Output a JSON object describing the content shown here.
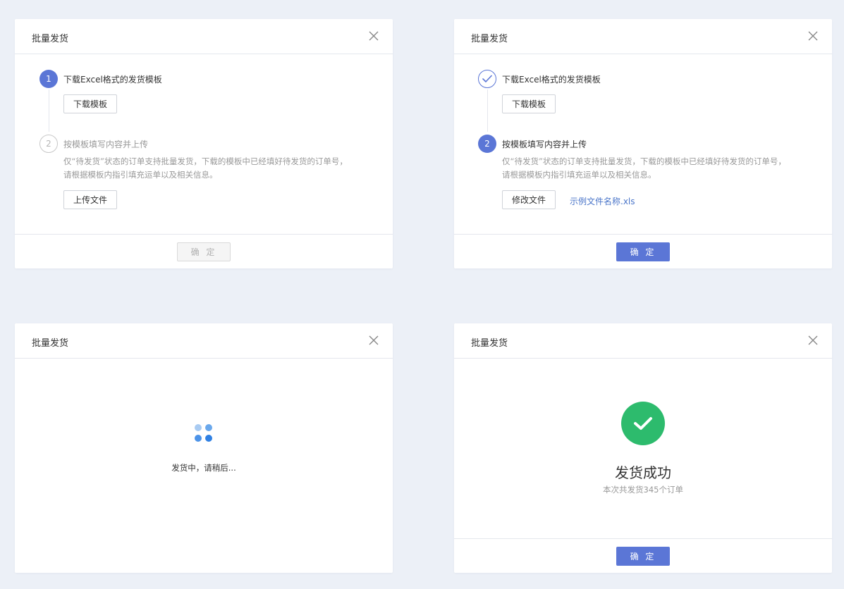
{
  "colors": {
    "primary": "#5b76d6",
    "success": "#2dbb6d",
    "link": "#4a75c9",
    "background": "#ecf0f7"
  },
  "dialog_title": "批量发货",
  "close_icon": "close-icon",
  "step1": {
    "number": "1",
    "title": "下载Excel格式的发货模板",
    "button": "下载模板"
  },
  "step2": {
    "number": "2",
    "title": "按模板填写内容并上传",
    "desc_line1": "仅“待发货”状态的订单支持批量发货，下载的模板中已经填好待发货的订单号，",
    "desc_line2": "请根据模板内指引填充运单以及相关信息。",
    "upload_button": "上传文件",
    "modify_button": "修改文件",
    "file_name": "示例文件名称.xls"
  },
  "confirm_button": "确 定",
  "loading": {
    "text": "发货中，请稍后..."
  },
  "success": {
    "title": "发货成功",
    "subtitle": "本次共发货345个订单"
  }
}
